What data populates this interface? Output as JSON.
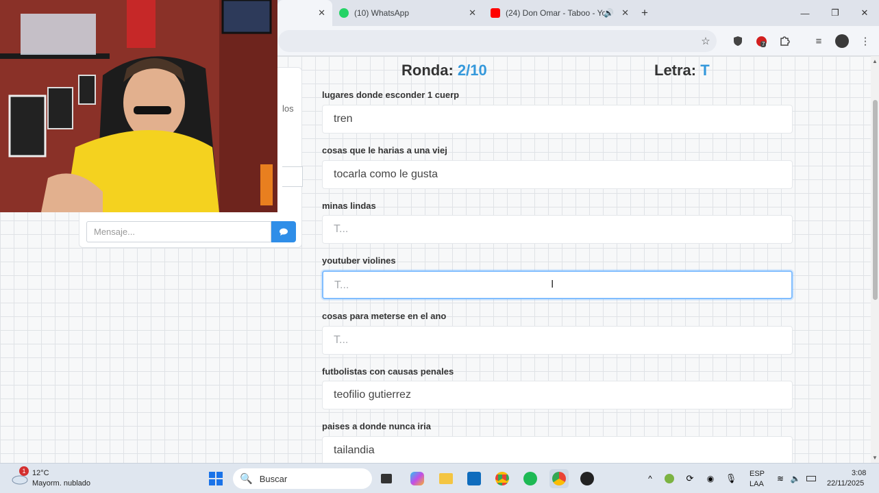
{
  "browser": {
    "tabs": [
      {
        "label": "",
        "active": true
      },
      {
        "label": "(10) WhatsApp",
        "favicon_color": "#25d366"
      },
      {
        "label": "(24) Don Omar - Taboo - Yo",
        "favicon_color": "#ff0000"
      }
    ],
    "window_controls": [
      "minimize",
      "restore",
      "close"
    ],
    "extension_badge": "7"
  },
  "game": {
    "ronda_label": "Ronda:",
    "ronda_value": "2/10",
    "letra_label": "Letra:",
    "letra_value": "T",
    "accent_color": "#3498db",
    "questions": [
      {
        "label": "lugares donde esconder 1 cuerp",
        "value": "tren",
        "placeholder": ""
      },
      {
        "label": "cosas que le harias a una viej",
        "value": "tocarla como le gusta",
        "placeholder": ""
      },
      {
        "label": "minas lindas",
        "value": "",
        "placeholder": "T..."
      },
      {
        "label": "youtuber violines",
        "value": "",
        "placeholder": "T...",
        "focused": true
      },
      {
        "label": "cosas para meterse en el ano",
        "value": "",
        "placeholder": "T..."
      },
      {
        "label": "futbolistas con causas penales",
        "value": "teofilio gutierrez",
        "placeholder": ""
      },
      {
        "label": "paises a donde nunca iria",
        "value": "tailandia",
        "placeholder": ""
      }
    ]
  },
  "chat": {
    "snippet": "los",
    "input_placeholder": "Mensaje...",
    "send_icon": "comment-icon"
  },
  "taskbar": {
    "weather_temp": "12°C",
    "weather_desc": "Mayorm. nublado",
    "weather_badge": "1",
    "search_placeholder": "Buscar",
    "lang_1": "ESP",
    "lang_2": "LAA",
    "time": "3:08",
    "date": "22/11/2025"
  }
}
